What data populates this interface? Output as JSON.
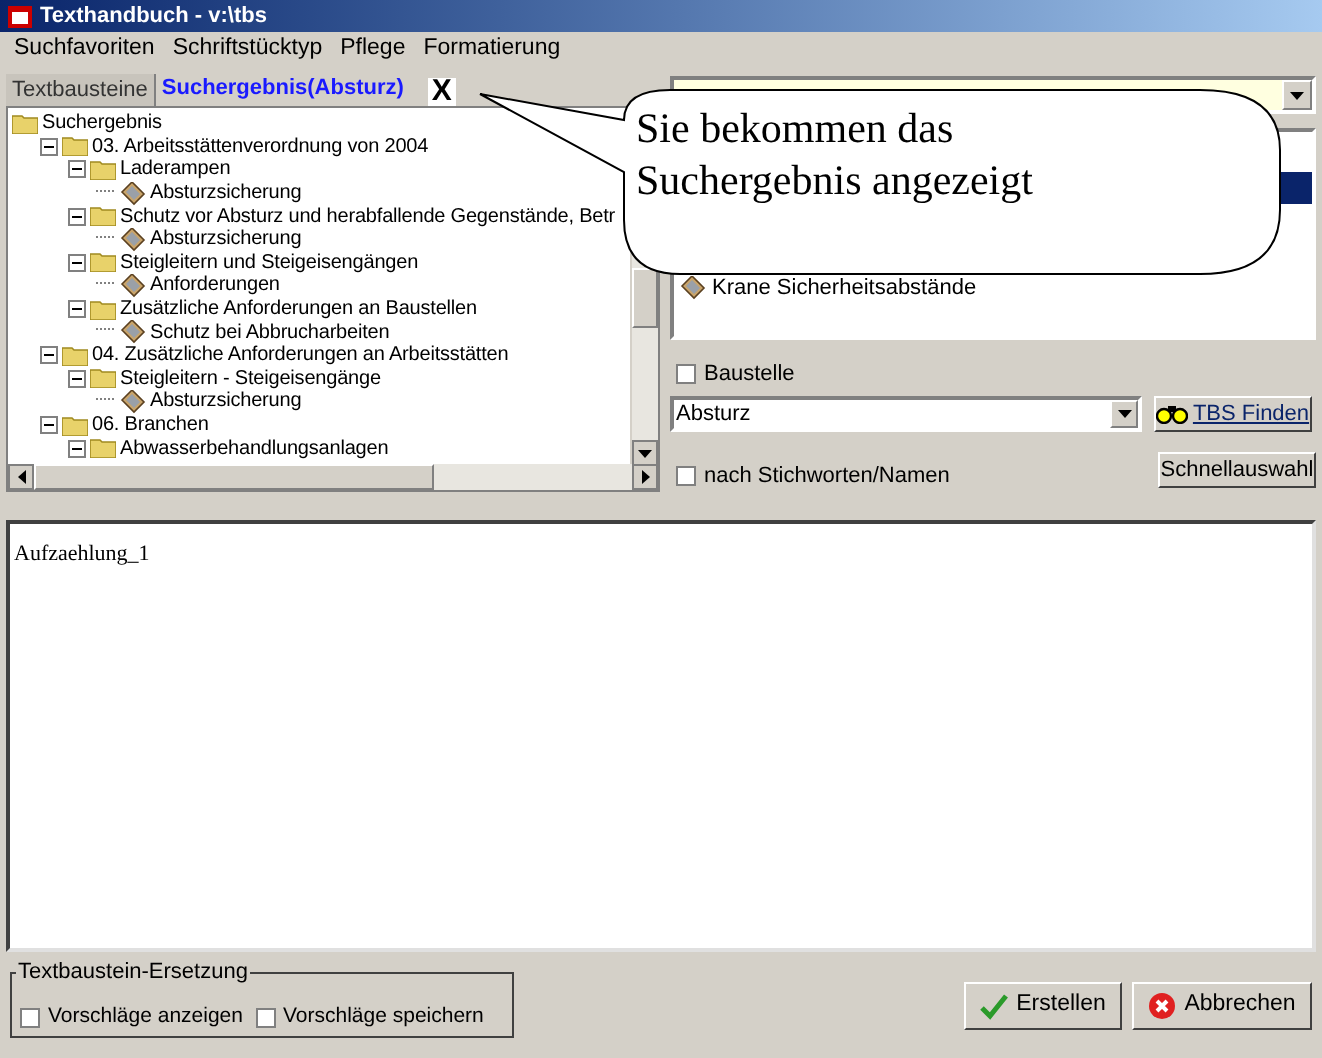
{
  "window": {
    "title": "Texthandbuch  -  v:\\tbs"
  },
  "menu": [
    "Suchfavoriten",
    "Schriftstücktyp",
    "Pflege",
    "Formatierung"
  ],
  "tabs": [
    {
      "label": "Textbausteine",
      "selected": false
    },
    {
      "label": "Suchergebnis(Absturz)",
      "selected": true
    }
  ],
  "tab_close": "X",
  "tree": {
    "label": "Suchergebnis",
    "children": [
      {
        "kind": "folder",
        "label": "03. Arbeitsstättenverordnung von 2004",
        "expanded": true,
        "children": [
          {
            "kind": "folder",
            "label": "Laderampen",
            "expanded": true,
            "children": [
              {
                "kind": "document",
                "label": "Absturzsicherung"
              }
            ]
          },
          {
            "kind": "folder",
            "label": "Schutz vor Absturz und herabfallende Gegenstände, Betr",
            "expanded": true,
            "children": [
              {
                "kind": "document",
                "label": "Absturzsicherung"
              }
            ]
          },
          {
            "kind": "folder",
            "label": "Steigleitern und Steigeisengängen",
            "expanded": true,
            "children": [
              {
                "kind": "document",
                "label": "Anforderungen"
              }
            ]
          },
          {
            "kind": "folder",
            "label": "Zusätzliche Anforderungen an Baustellen",
            "expanded": true,
            "children": [
              {
                "kind": "document",
                "label": "Schutz bei Abbrucharbeiten"
              }
            ]
          }
        ]
      },
      {
        "kind": "folder",
        "label": "04. Zusätzliche Anforderungen an Arbeitsstätten",
        "expanded": true,
        "children": [
          {
            "kind": "folder",
            "label": "Steigleitern - Steigeisengänge",
            "expanded": true,
            "children": [
              {
                "kind": "document",
                "label": "Absturzsicherung"
              }
            ]
          }
        ]
      },
      {
        "kind": "folder",
        "label": "06. Branchen",
        "expanded": true,
        "children": [
          {
            "kind": "folder",
            "label": "Abwasserbehandlungsanlagen",
            "expanded": true
          }
        ]
      }
    ]
  },
  "result_list": [
    {
      "selected": true
    },
    {
      "label": "Krane Sicherheitsabstände",
      "selected": false
    }
  ],
  "baustelle_checkbox": {
    "label": "Baustelle",
    "checked": false
  },
  "search_combo": {
    "value": "Absturz"
  },
  "find_button": "TBS Finden",
  "keywords_checkbox": {
    "label": "nach Stichworten/Namen",
    "checked": false
  },
  "quick_button": "Schnellauswahl",
  "editor_text": "Aufzaehlung_1",
  "replacement_group": {
    "title": "Textbaustein-Ersetzung",
    "options": [
      {
        "label": "Vorschläge anzeigen",
        "checked": false
      },
      {
        "label": "Vorschläge speichern",
        "checked": false
      }
    ]
  },
  "buttons": [
    {
      "kind": "ok",
      "label": "Erstellen"
    },
    {
      "kind": "cancel",
      "label": "Abbrechen"
    }
  ],
  "callout": [
    "Sie bekommen das",
    "Suchergebnis angezeigt"
  ]
}
